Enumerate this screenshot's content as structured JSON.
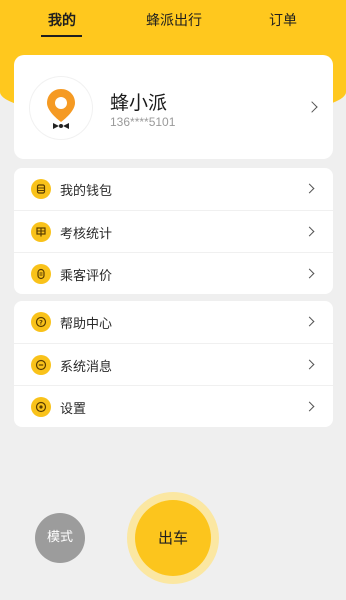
{
  "tabs": [
    {
      "label": "我的"
    },
    {
      "label": "蜂派出行"
    },
    {
      "label": "订单"
    }
  ],
  "profile": {
    "name": "蜂小派",
    "phone": "136****5101"
  },
  "menu_group_1": [
    {
      "label": "我的钱包",
      "icon": "wallet-icon"
    },
    {
      "label": "考核统计",
      "icon": "stats-icon"
    },
    {
      "label": "乘客评价",
      "icon": "review-icon"
    }
  ],
  "menu_group_2": [
    {
      "label": "帮助中心",
      "icon": "help-icon"
    },
    {
      "label": "系统消息",
      "icon": "message-icon"
    },
    {
      "label": "设置",
      "icon": "settings-icon"
    }
  ],
  "actions": {
    "mode_label": "模式",
    "go_label": "出车"
  },
  "colors": {
    "brand_yellow": "#ffc81e",
    "icon_yellow": "#f9c21a",
    "mode_gray": "#9c9c9c",
    "logo_orange": "#f59a23"
  }
}
